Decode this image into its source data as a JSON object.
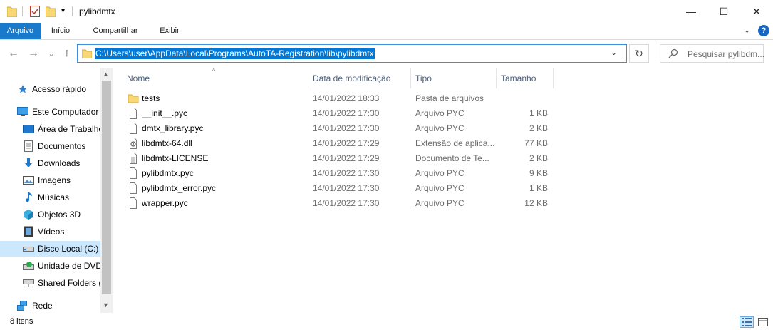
{
  "window": {
    "title": "pylibdmtx",
    "minimize": "—",
    "maximize": "☐",
    "close": "✕"
  },
  "ribbon": {
    "tabs": [
      "Arquivo",
      "Início",
      "Compartilhar",
      "Exibir"
    ],
    "help": "?"
  },
  "navigation": {
    "back": "←",
    "forward": "→",
    "recent": "⌄",
    "up": "↑",
    "address": "C:\\Users\\user\\AppData\\Local\\Programs\\AutoTA-Registration\\lib\\pylibdmtx",
    "refresh": "↻",
    "search_placeholder": "Pesquisar pylibdm..."
  },
  "sidebar": {
    "items": [
      {
        "label": "Acesso rápido",
        "icon": "star-icon"
      },
      {
        "label": "Este Computador",
        "icon": "computer-icon"
      },
      {
        "label": "Área de Trabalho",
        "icon": "desktop-icon"
      },
      {
        "label": "Documentos",
        "icon": "documents-icon"
      },
      {
        "label": "Downloads",
        "icon": "download-icon"
      },
      {
        "label": "Imagens",
        "icon": "pictures-icon"
      },
      {
        "label": "Músicas",
        "icon": "music-icon"
      },
      {
        "label": "Objetos 3D",
        "icon": "cube-icon"
      },
      {
        "label": "Vídeos",
        "icon": "video-icon"
      },
      {
        "label": "Disco Local (C:)",
        "icon": "drive-icon",
        "selected": true
      },
      {
        "label": "Unidade de DVD",
        "icon": "dvd-icon"
      },
      {
        "label": "Shared Folders (\\",
        "icon": "network-drive-icon"
      },
      {
        "label": "Rede",
        "icon": "network-icon"
      }
    ]
  },
  "columns": {
    "name": "Nome",
    "date": "Data de modificação",
    "type": "Tipo",
    "size": "Tamanho"
  },
  "files": [
    {
      "name": "tests",
      "date": "14/01/2022 18:33",
      "type": "Pasta de arquivos",
      "size": "",
      "icon": "folder-icon"
    },
    {
      "name": "__init__.pyc",
      "date": "14/01/2022 17:30",
      "type": "Arquivo PYC",
      "size": "1 KB",
      "icon": "file-icon"
    },
    {
      "name": "dmtx_library.pyc",
      "date": "14/01/2022 17:30",
      "type": "Arquivo PYC",
      "size": "2 KB",
      "icon": "file-icon"
    },
    {
      "name": "libdmtx-64.dll",
      "date": "14/01/2022 17:29",
      "type": "Extensão de aplica...",
      "size": "77 KB",
      "icon": "dll-icon"
    },
    {
      "name": "libdmtx-LICENSE",
      "date": "14/01/2022 17:29",
      "type": "Documento de Te...",
      "size": "2 KB",
      "icon": "text-file-icon"
    },
    {
      "name": "pylibdmtx.pyc",
      "date": "14/01/2022 17:30",
      "type": "Arquivo PYC",
      "size": "9 KB",
      "icon": "file-icon"
    },
    {
      "name": "pylibdmtx_error.pyc",
      "date": "14/01/2022 17:30",
      "type": "Arquivo PYC",
      "size": "1 KB",
      "icon": "file-icon"
    },
    {
      "name": "wrapper.pyc",
      "date": "14/01/2022 17:30",
      "type": "Arquivo PYC",
      "size": "12 KB",
      "icon": "file-icon"
    }
  ],
  "status": {
    "item_count": "8 itens"
  },
  "colors": {
    "accent": "#1979ca",
    "selection": "#0078d7",
    "sidebar_selected": "#cce8ff",
    "folder": "#f8d775"
  }
}
